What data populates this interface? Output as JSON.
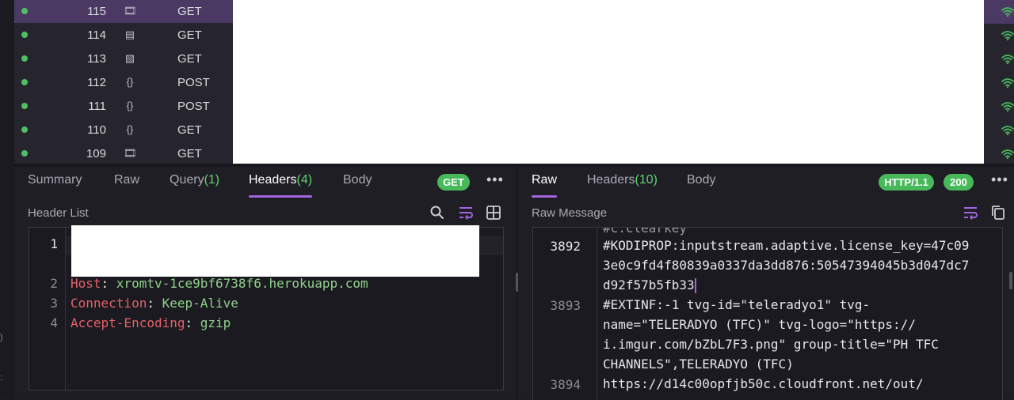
{
  "requests": [
    {
      "id": "115",
      "icon": "film-icon",
      "glyph": "🎞",
      "method": "GET",
      "selected": true
    },
    {
      "id": "114",
      "icon": "document-icon",
      "glyph": "▤",
      "method": "GET",
      "selected": false
    },
    {
      "id": "113",
      "icon": "image-icon",
      "glyph": "▧",
      "method": "GET",
      "selected": false
    },
    {
      "id": "112",
      "icon": "json-icon",
      "glyph": "{}",
      "method": "POST",
      "selected": false
    },
    {
      "id": "111",
      "icon": "json-icon",
      "glyph": "{}",
      "method": "POST",
      "selected": false
    },
    {
      "id": "110",
      "icon": "json-icon",
      "glyph": "{}",
      "method": "GET",
      "selected": false
    },
    {
      "id": "109",
      "icon": "film-icon",
      "glyph": "🎞",
      "method": "GET",
      "selected": false
    }
  ],
  "left_tabs": {
    "summary": "Summary",
    "raw": "Raw",
    "query": "Query",
    "query_count": "(1)",
    "headers": "Headers",
    "headers_count": "(4)",
    "body": "Body",
    "method_badge": "GET",
    "more": "•••"
  },
  "left_sub": {
    "title": "Header List"
  },
  "header_lines": [
    {
      "num": "1",
      "key": "",
      "value": ""
    },
    {
      "num": "2",
      "key": "Host",
      "value": "xromtv-1ce9bf6738f6.herokuapp.com"
    },
    {
      "num": "3",
      "key": "Connection",
      "value": "Keep-Alive"
    },
    {
      "num": "4",
      "key": "Accept-Encoding",
      "value": "gzip"
    }
  ],
  "right_tabs": {
    "raw": "Raw",
    "headers": "Headers",
    "headers_count": "(10)",
    "body": "Body",
    "http_badge": "HTTP/1.1",
    "status_badge": "200",
    "more": "•••"
  },
  "right_sub": {
    "title": "Raw Message"
  },
  "raw_lines": {
    "partial_top": "#c:clearkey",
    "l3892_num": "3892",
    "l3892_a": "#KODIPROP:inputstream.adaptive.license_key=47c09",
    "l3892_b": "3e0c9fd4f80839a0337da3dd876:50547394045b3d047dc7",
    "l3892_c": "d92f57b5fb33",
    "l3893_num": "3893",
    "l3893_a": "#EXTINF:-1 tvg-id=\"teleradyo1\" tvg-",
    "l3893_b": "name=\"TELERADYO (TFC)\" tvg-logo=\"https://",
    "l3893_c": "i.imgur.com/bZbL7F3.png\" group-title=\"PH TFC",
    "l3893_d": "CHANNELS\",TELERADYO (TFC)",
    "l3894_num": "3894",
    "l3894_a": "https://d14c00opfjb50c.cloudfront.net/out/"
  },
  "colors": {
    "accent": "#a264e0",
    "success": "#48b95a",
    "count_green": "#5fd36d",
    "key_red": "#e5606a",
    "value_green": "#8fd18a"
  }
}
